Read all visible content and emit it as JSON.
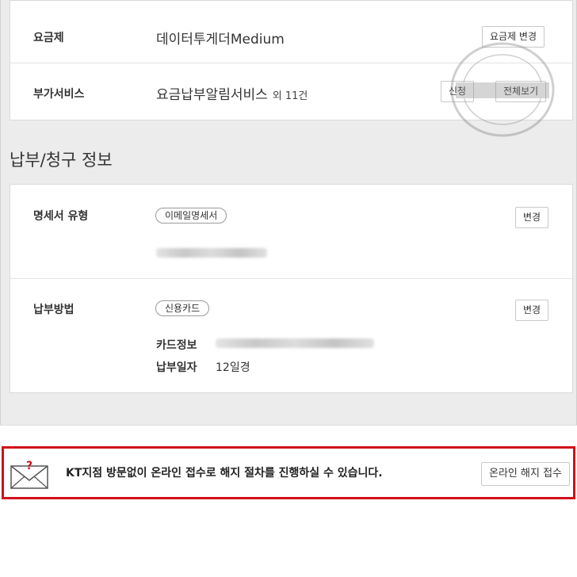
{
  "plan_card": {
    "rows": [
      {
        "label": "요금제",
        "value": "데이터투게더Medium",
        "buttons": [
          "요금제 변경"
        ]
      },
      {
        "label": "부가서비스",
        "value": "요금납부알림서비스",
        "count": "외 11건",
        "buttons": [
          "신청",
          "전체보기"
        ]
      }
    ]
  },
  "billing": {
    "section_title": "납부/청구 정보",
    "statement": {
      "label": "명세서 유형",
      "tag": "이메일명세서",
      "button": "변경"
    },
    "payment": {
      "label": "납부방법",
      "tag": "신용카드",
      "button": "변경",
      "card_info_label": "카드정보",
      "pay_day_label": "납부일자",
      "pay_day_value": "12일경"
    }
  },
  "notice": {
    "text": "KT지점 방문없이 온라인 접수로 해지 절차를 진행하실 수 있습니다.",
    "button": "온라인 해지 접수",
    "accent_color": "#d1111a"
  },
  "icons": [
    "envelope-question-icon"
  ]
}
